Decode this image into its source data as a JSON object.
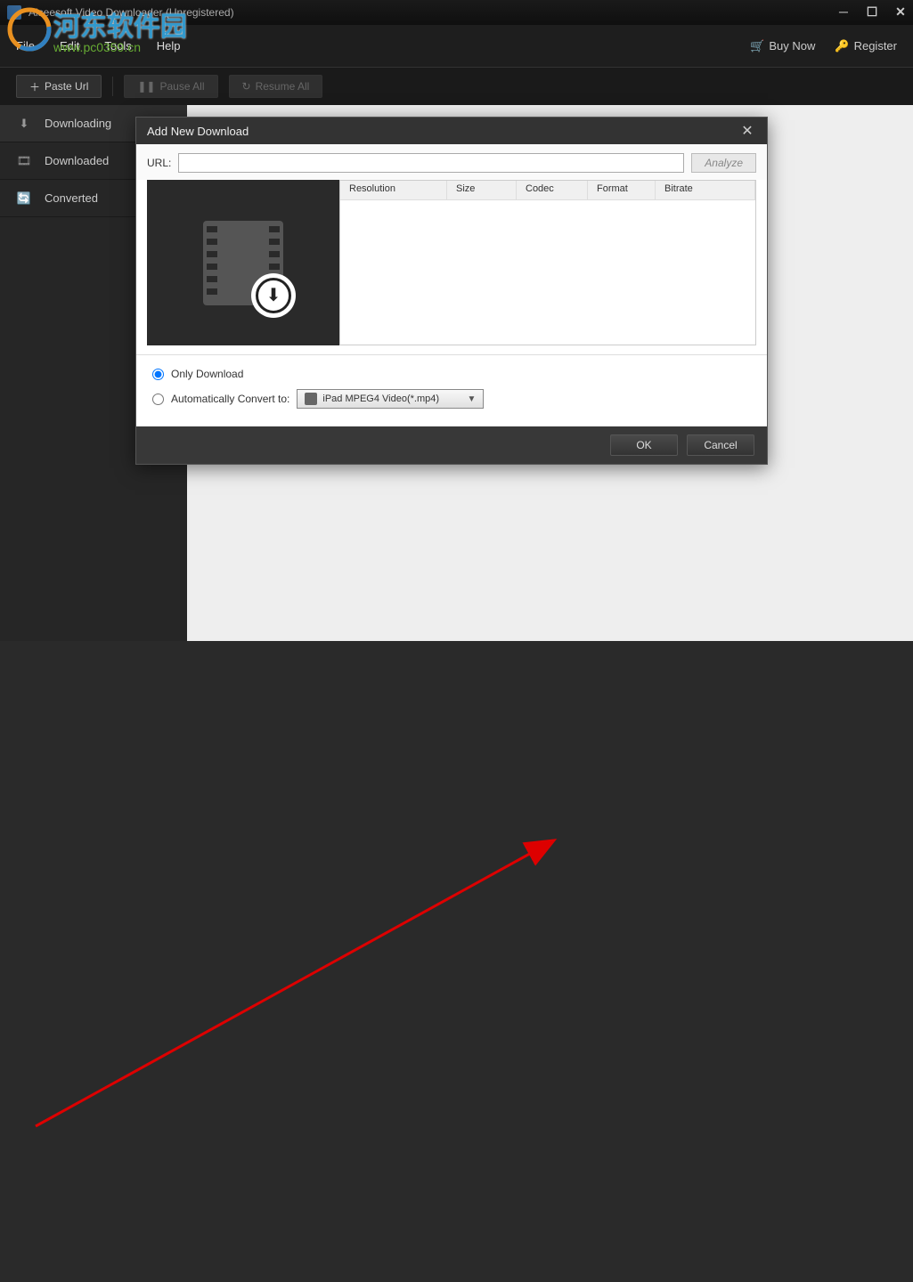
{
  "window": {
    "title": "Aiseesoft Video Downloader (Unregistered)"
  },
  "watermark": {
    "text": "河东软件园",
    "url": "www.pc0359.cn"
  },
  "menu": {
    "file": "File",
    "edit": "Edit",
    "tools": "Tools",
    "help": "Help",
    "buy_now": "Buy Now",
    "register": "Register"
  },
  "toolbar": {
    "paste_url": "Paste Url",
    "pause_all": "Pause All",
    "resume_all": "Resume All"
  },
  "sidebar": {
    "items": [
      {
        "label": "Downloading",
        "icon": "download"
      },
      {
        "label": "Downloaded",
        "icon": "video-file"
      },
      {
        "label": "Converted",
        "icon": "refresh"
      }
    ]
  },
  "dialog": {
    "title": "Add New Download",
    "url_label": "URL:",
    "url_value": "",
    "analyze": "Analyze",
    "columns": {
      "resolution": "Resolution",
      "size": "Size",
      "codec": "Codec",
      "format": "Format",
      "bitrate": "Bitrate"
    },
    "only_download": "Only Download",
    "auto_convert": "Automatically Convert to:",
    "convert_format": "iPad MPEG4 Video(*.mp4)",
    "ok": "OK",
    "cancel": "Cancel"
  }
}
